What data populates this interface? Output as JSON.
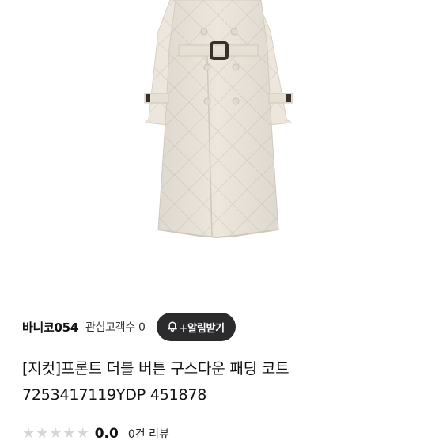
{
  "seller": {
    "store_name": "바니코054",
    "interest_label": "관심고객수 0",
    "alarm_button": "+알림받기"
  },
  "product": {
    "title_line1": "[지컷]프론트 더블 버튼 구스다운 패딩 코트",
    "title_line2": "7253417119YDP 451878",
    "image_icon": "padded-coat-image"
  },
  "rating": {
    "stars_filled": 0,
    "stars_total": 5,
    "score": "0.0",
    "review_count_label": "0건 리뷰"
  },
  "colors": {
    "alarm_button_bg": "#2b2b2d",
    "star_empty": "#d6d6d6",
    "coat": "#ece6dc"
  }
}
